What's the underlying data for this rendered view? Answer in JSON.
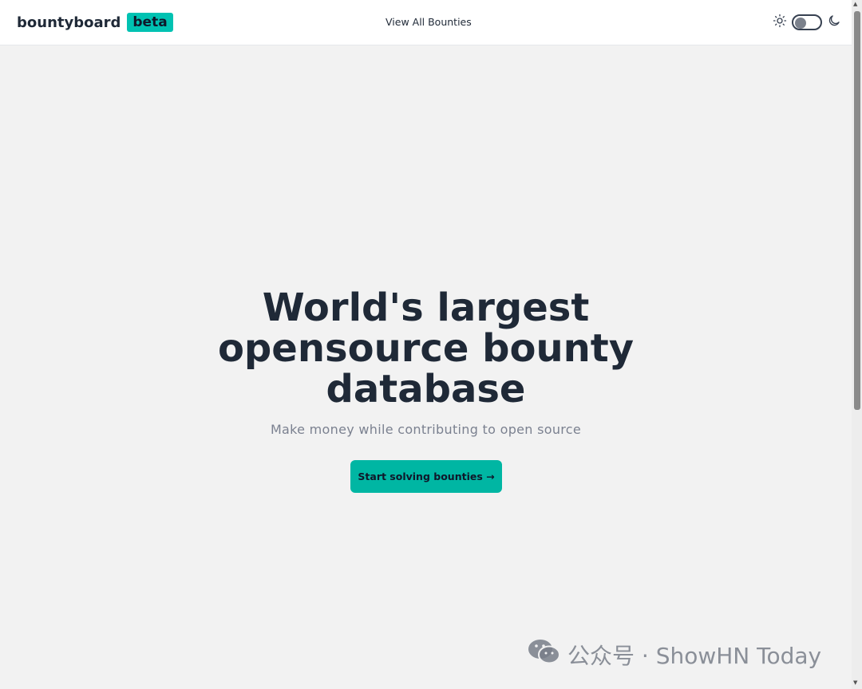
{
  "navbar": {
    "brand": "bountyboard",
    "badge": "beta",
    "link": "View All Bounties"
  },
  "theme_toggle": {
    "sun_icon": "sun-icon",
    "moon_icon": "moon-icon",
    "state": "light"
  },
  "hero": {
    "title": "World's largest opensource bounty database",
    "subtitle": "Make money while contributing to open source",
    "cta": "Start solving bounties →"
  },
  "watermark": {
    "text": "公众号 · ShowHN Today",
    "icon": "wechat-icon"
  },
  "colors": {
    "accent": "#00c2b2",
    "button": "#00b6a3",
    "text": "#1f2937",
    "background": "#f2f2f2"
  }
}
